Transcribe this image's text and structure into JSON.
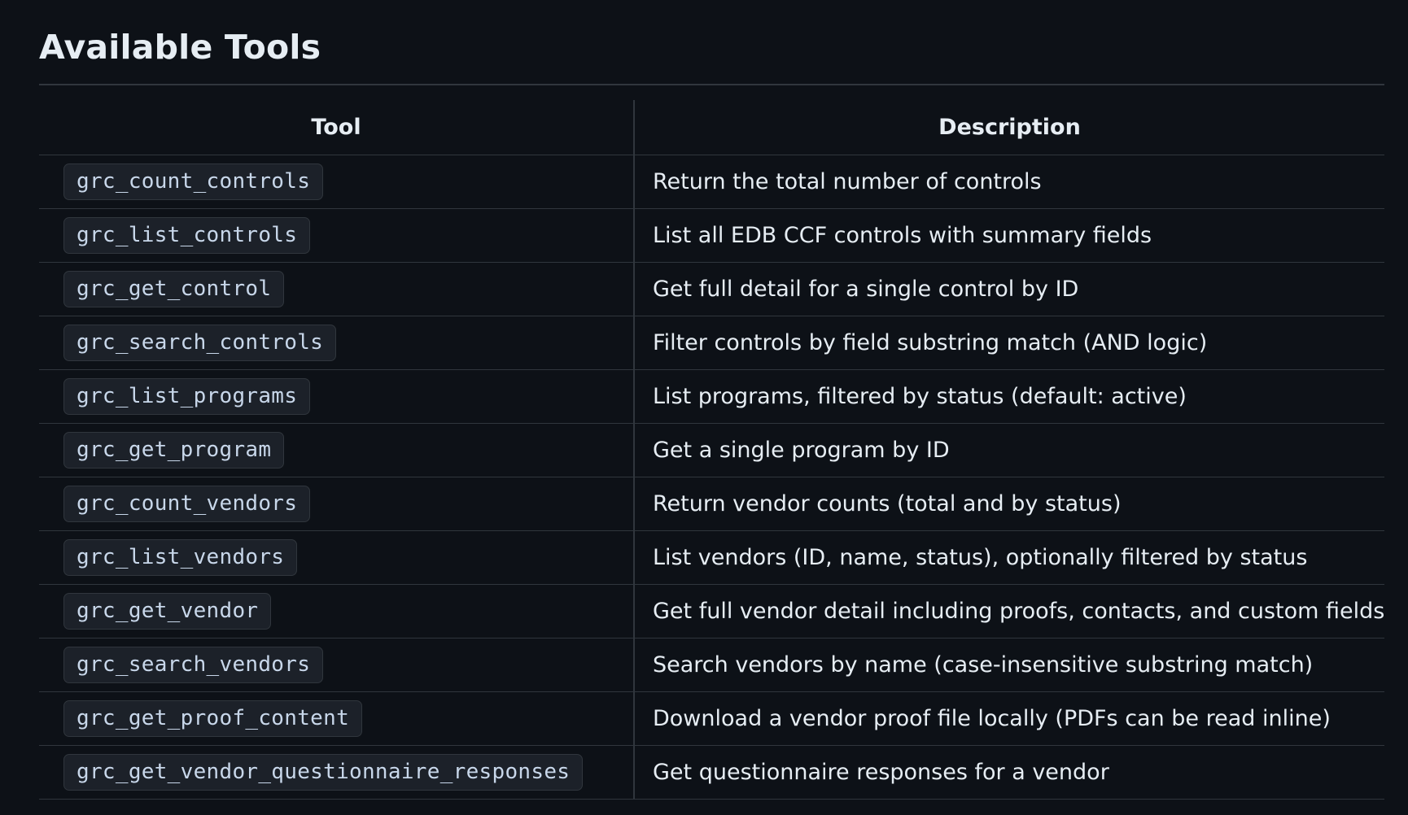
{
  "heading": "Available Tools",
  "table": {
    "headers": {
      "tool": "Tool",
      "description": "Description"
    },
    "rows": [
      {
        "tool": "grc_count_controls",
        "description": "Return the total number of controls"
      },
      {
        "tool": "grc_list_controls",
        "description": "List all EDB CCF controls with summary fields"
      },
      {
        "tool": "grc_get_control",
        "description": "Get full detail for a single control by ID"
      },
      {
        "tool": "grc_search_controls",
        "description": "Filter controls by field substring match (AND logic)"
      },
      {
        "tool": "grc_list_programs",
        "description": "List programs, filtered by status (default: active)"
      },
      {
        "tool": "grc_get_program",
        "description": "Get a single program by ID"
      },
      {
        "tool": "grc_count_vendors",
        "description": "Return vendor counts (total and by status)"
      },
      {
        "tool": "grc_list_vendors",
        "description": "List vendors (ID, name, status), optionally filtered by status"
      },
      {
        "tool": "grc_get_vendor",
        "description": "Get full vendor detail including proofs, contacts, and custom fields"
      },
      {
        "tool": "grc_search_vendors",
        "description": "Search vendors by name (case-insensitive substring match)"
      },
      {
        "tool": "grc_get_proof_content",
        "description": "Download a vendor proof file locally (PDFs can be read inline)"
      },
      {
        "tool": "grc_get_vendor_questionnaire_responses",
        "description": "Get questionnaire responses for a vendor"
      }
    ]
  },
  "colors": {
    "background": "#0d1117",
    "text": "#e6edf3",
    "border": "#30363d",
    "code_background": "#1c2129"
  }
}
